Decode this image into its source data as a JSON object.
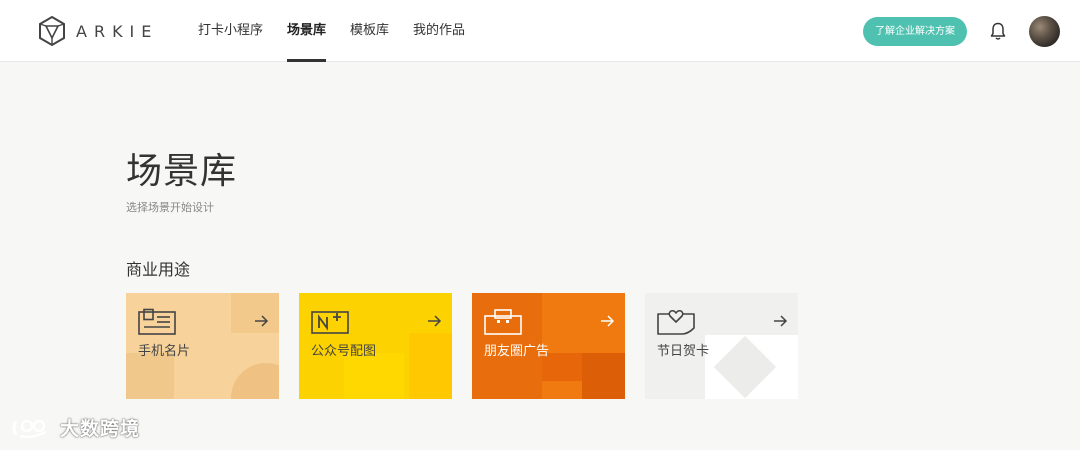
{
  "header": {
    "logo_text": "ARKIE",
    "nav": [
      {
        "label": "打卡小程序",
        "active": false
      },
      {
        "label": "场景库",
        "active": true
      },
      {
        "label": "模板库",
        "active": false
      },
      {
        "label": "我的作品",
        "active": false
      }
    ],
    "cta_label": "了解企业解决方案",
    "icons": {
      "bell": "bell-icon",
      "avatar": "avatar"
    }
  },
  "main": {
    "title": "场景库",
    "subtitle": "选择场景开始设计",
    "section_title": "商业用途",
    "cards": [
      {
        "label": "手机名片",
        "icon": "business-card-icon",
        "bg": "#f7d39b",
        "text_color": "#444444"
      },
      {
        "label": "公众号配图",
        "icon": "wechat-image-icon",
        "bg": "#fcd200",
        "text_color": "#444444"
      },
      {
        "label": "朋友圈广告",
        "icon": "ad-bag-icon",
        "bg": "#f07a10",
        "text_color": "#ffffff"
      },
      {
        "label": "节日贺卡",
        "icon": "heart-card-icon",
        "bg": "#f0f0ef",
        "text_color": "#444444"
      }
    ]
  },
  "watermark": {
    "text": "大数跨境"
  },
  "colors": {
    "accent": "#4fc1b0",
    "background": "#f7f7f5"
  }
}
